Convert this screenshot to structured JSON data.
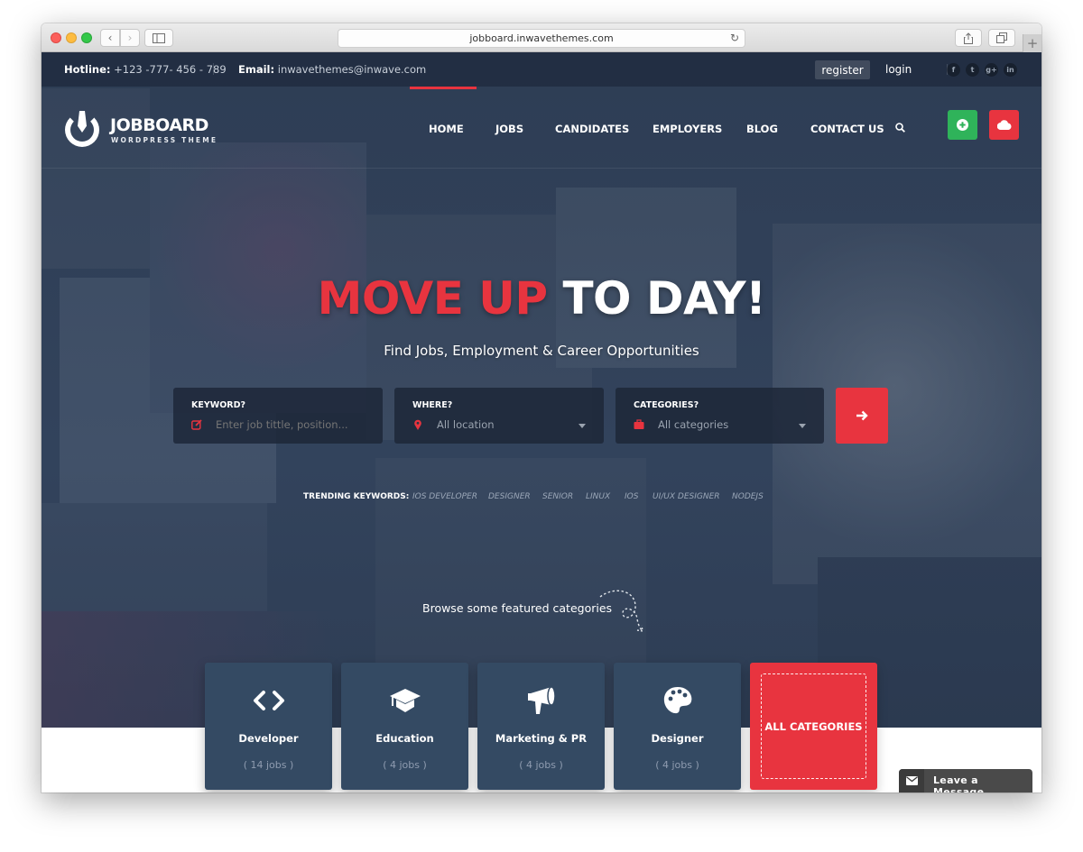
{
  "browser": {
    "url": "jobboard.inwavethemes.com",
    "icons": [
      "back-icon",
      "forward-icon",
      "sidebar-icon",
      "reload-icon",
      "share-icon",
      "tabs-icon",
      "new-tab-icon"
    ],
    "back_glyph": "‹",
    "forward_glyph": "›",
    "reload_glyph": "↻",
    "new_tab_glyph": "+"
  },
  "topbar": {
    "hotline_label": "Hotline:",
    "hotline_value": "+123 -777- 456 - 789",
    "email_label": "Email:",
    "email_value": "inwavethemes@inwave.com",
    "register_label": "register",
    "login_label": "login",
    "social": [
      {
        "name": "facebook",
        "glyph": "f"
      },
      {
        "name": "twitter",
        "glyph": "t"
      },
      {
        "name": "google-plus",
        "glyph": "g+"
      },
      {
        "name": "linkedin",
        "glyph": "in"
      }
    ]
  },
  "header": {
    "logo_title": "JOBBOARD",
    "logo_subtitle": "WORDPRESS THEME",
    "nav": [
      {
        "label": "HOME",
        "active": true
      },
      {
        "label": "JOBS",
        "active": false
      },
      {
        "label": "CANDIDATES",
        "active": false
      },
      {
        "label": "EMPLOYERS",
        "active": false
      },
      {
        "label": "BLOG",
        "active": false
      },
      {
        "label": "CONTACT US",
        "active": false
      }
    ],
    "post_button_icon": "plus-circle-icon",
    "upload_button_icon": "cloud-icon"
  },
  "hero": {
    "title_accent": "MOVE UP",
    "title_rest": " TO DAY!",
    "subtitle": "Find Jobs, Employment & Career Opportunities"
  },
  "search": {
    "keyword": {
      "label": "KEYWORD?",
      "placeholder": "Enter job tittle, position...",
      "value": ""
    },
    "where": {
      "label": "WHERE?",
      "value": "All location"
    },
    "categories": {
      "label": "CATEGORIES?",
      "value": "All categories"
    },
    "submit_icon": "arrow-right-icon"
  },
  "trending": {
    "label": "TRENDING KEYWORDS:",
    "keywords": [
      "IOS DEVELOPER",
      "DESIGNER",
      "SENIOR",
      "LINUX",
      "IOS",
      "UI/UX DESIGNER",
      "NODEJS"
    ]
  },
  "browse": {
    "text": "Browse some featured categories"
  },
  "categories": [
    {
      "name": "Developer",
      "count": "( 14 jobs )",
      "icon": "code-icon"
    },
    {
      "name": "Education",
      "count": "( 4 jobs )",
      "icon": "graduation-cap-icon"
    },
    {
      "name": "Marketing & PR",
      "count": "( 4 jobs )",
      "icon": "megaphone-icon"
    },
    {
      "name": "Designer",
      "count": "( 4 jobs )",
      "icon": "palette-icon"
    }
  ],
  "all_categories_label": "ALL CATEGORIES",
  "chat": {
    "label": "Leave a Message"
  },
  "colors": {
    "accent_red": "#e8343f",
    "accent_green": "#2fb35a",
    "card_bg": "#344a63",
    "hero_bg": "#3b4d66"
  }
}
